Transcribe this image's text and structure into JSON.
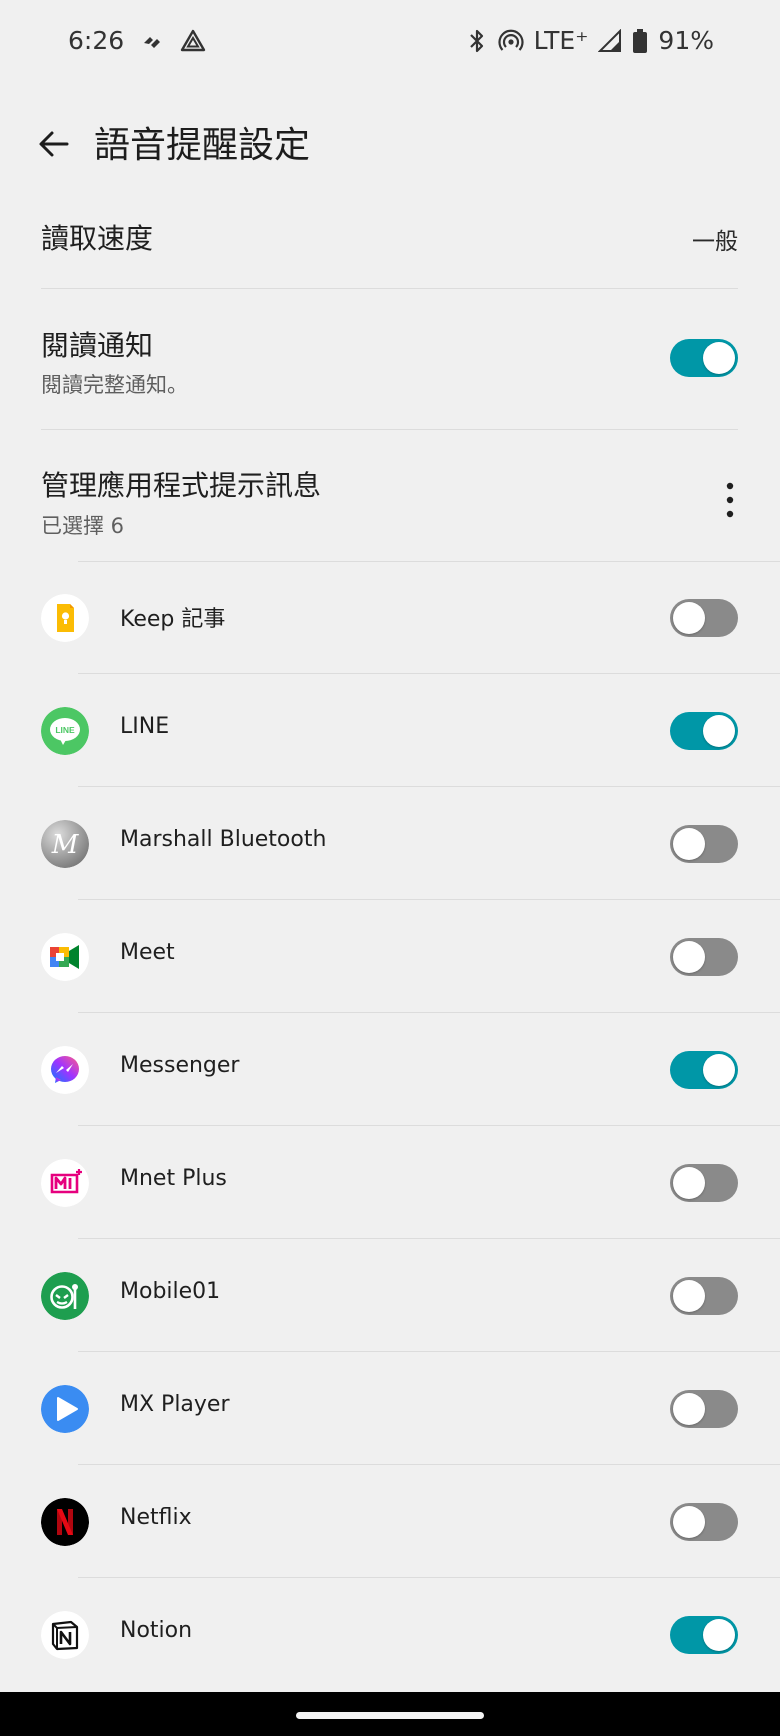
{
  "status": {
    "time": "6:26",
    "network": "LTE⁺",
    "battery": "91%"
  },
  "header": {
    "title": "語音提醒設定"
  },
  "settings": {
    "read_speed": {
      "label": "讀取速度",
      "value": "一般"
    },
    "read_notifications": {
      "label": "閱讀通知",
      "sub": "閱讀完整通知。",
      "enabled": true
    },
    "manage_apps": {
      "label": "管理應用程式提示訊息",
      "sub": "已選擇 6"
    }
  },
  "apps": [
    {
      "name": "Keep 記事",
      "icon": "keep-icon",
      "enabled": false
    },
    {
      "name": "LINE",
      "icon": "line-icon",
      "enabled": true
    },
    {
      "name": "Marshall Bluetooth",
      "icon": "marshall-icon",
      "enabled": false
    },
    {
      "name": "Meet",
      "icon": "meet-icon",
      "enabled": false
    },
    {
      "name": "Messenger",
      "icon": "messenger-icon",
      "enabled": true
    },
    {
      "name": "Mnet Plus",
      "icon": "mnet-plus-icon",
      "enabled": false
    },
    {
      "name": "Mobile01",
      "icon": "mobile01-icon",
      "enabled": false
    },
    {
      "name": "MX Player",
      "icon": "mx-player-icon",
      "enabled": false
    },
    {
      "name": "Netflix",
      "icon": "netflix-icon",
      "enabled": false
    },
    {
      "name": "Notion",
      "icon": "notion-icon",
      "enabled": true
    }
  ],
  "colors": {
    "accent": "#0097a7",
    "switch_off": "#8a8a8a",
    "background": "#f0f0f0"
  }
}
